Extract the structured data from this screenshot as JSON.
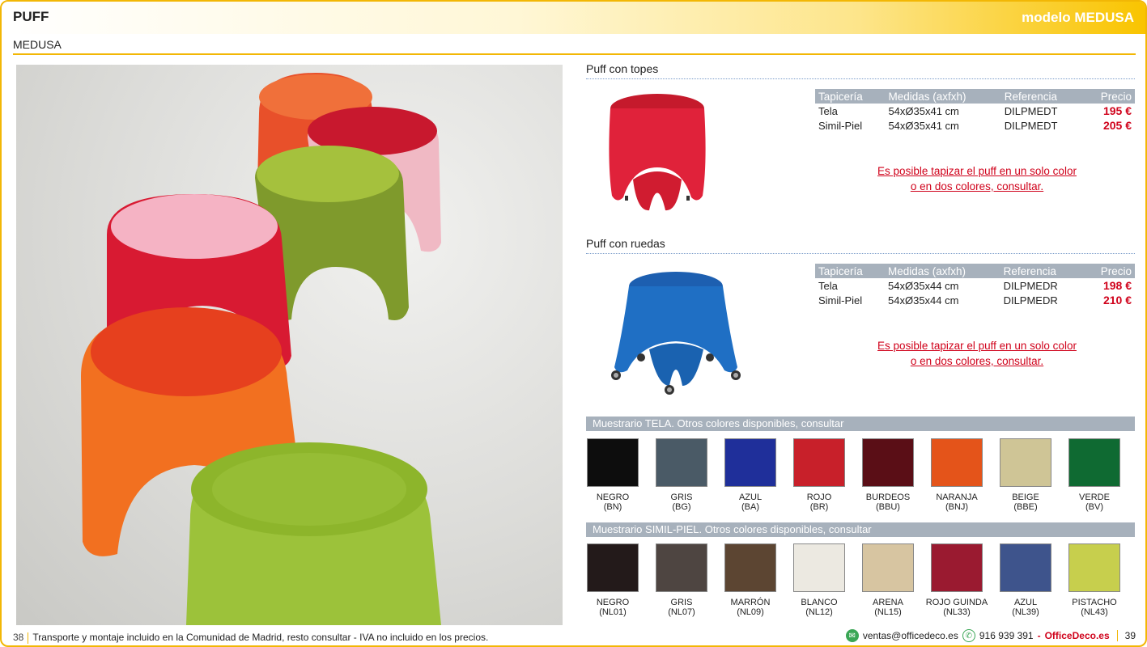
{
  "header": {
    "title": "PUFF",
    "model": "modelo MEDUSA"
  },
  "subtitle": "MEDUSA",
  "sections": [
    {
      "title": "Puff con topes",
      "columns": [
        "Tapicería",
        "Medidas (axfxh)",
        "Referencia",
        "Precio"
      ],
      "rows": [
        {
          "tapiceria": "Tela",
          "medidas": "54xØ35x41 cm",
          "referencia": "DILPMEDT",
          "precio": "195 €"
        },
        {
          "tapiceria": "Simil-Piel",
          "medidas": "54xØ35x41 cm",
          "referencia": "DILPMEDT",
          "precio": "205 €"
        }
      ],
      "note_line1": "Es posible tapizar el puff en un solo color",
      "note_line2": "o en dos colores, consultar."
    },
    {
      "title": "Puff con ruedas",
      "columns": [
        "Tapicería",
        "Medidas (axfxh)",
        "Referencia",
        "Precio"
      ],
      "rows": [
        {
          "tapiceria": "Tela",
          "medidas": "54xØ35x44 cm",
          "referencia": "DILPMEDR",
          "precio": "198 €"
        },
        {
          "tapiceria": "Simil-Piel",
          "medidas": "54xØ35x44 cm",
          "referencia": "DILPMEDR",
          "precio": "210 €"
        }
      ],
      "note_line1": "Es posible tapizar el puff en un solo color",
      "note_line2": "o en dos colores, consultar."
    }
  ],
  "muestrario_tela": {
    "title": "Muestrario TELA. Otros colores disponibles, consultar",
    "items": [
      {
        "name": "NEGRO",
        "code": "(BN)",
        "color": "#0d0d0d"
      },
      {
        "name": "GRIS",
        "code": "(BG)",
        "color": "#4a5a66"
      },
      {
        "name": "AZUL",
        "code": "(BA)",
        "color": "#1f2f9a"
      },
      {
        "name": "ROJO",
        "code": "(BR)",
        "color": "#c8202a"
      },
      {
        "name": "BURDEOS",
        "code": "(BBU)",
        "color": "#5a0e16"
      },
      {
        "name": "NARANJA",
        "code": "(BNJ)",
        "color": "#e4541a"
      },
      {
        "name": "BEIGE",
        "code": "(BBE)",
        "color": "#cfc596"
      },
      {
        "name": "VERDE",
        "code": "(BV)",
        "color": "#0f6a32"
      }
    ]
  },
  "muestrario_simil": {
    "title": "Muestrario SIMIL-PIEL. Otros colores disponibles, consultar",
    "items": [
      {
        "name": "NEGRO",
        "code": "(NL01)",
        "color": "#231a1a"
      },
      {
        "name": "GRIS",
        "code": "(NL07)",
        "color": "#4e4541"
      },
      {
        "name": "MARRÓN",
        "code": "(NL09)",
        "color": "#5c4532"
      },
      {
        "name": "BLANCO",
        "code": "(NL12)",
        "color": "#ece9e1"
      },
      {
        "name": "ARENA",
        "code": "(NL15)",
        "color": "#d7c5a1"
      },
      {
        "name": "ROJO GUINDA",
        "code": "(NL33)",
        "color": "#9a1a30"
      },
      {
        "name": "AZUL",
        "code": "(NL39)",
        "color": "#3e548c"
      },
      {
        "name": "PISTACHO",
        "code": "(NL43)",
        "color": "#c7cf4d"
      }
    ]
  },
  "footer": {
    "page_left": "38",
    "text": "Transporte y montaje incluido en la Comunidad de Madrid, resto consultar - IVA no incluido en los precios.",
    "email": "ventas@officedeco.es",
    "phone": "916 939 391",
    "dash": "-",
    "brand": "OfficeDeco.es",
    "page_right": "39"
  },
  "colors": {
    "accent": "#f2b705",
    "price": "#d0021b",
    "table_header": "#a7b1bc"
  }
}
